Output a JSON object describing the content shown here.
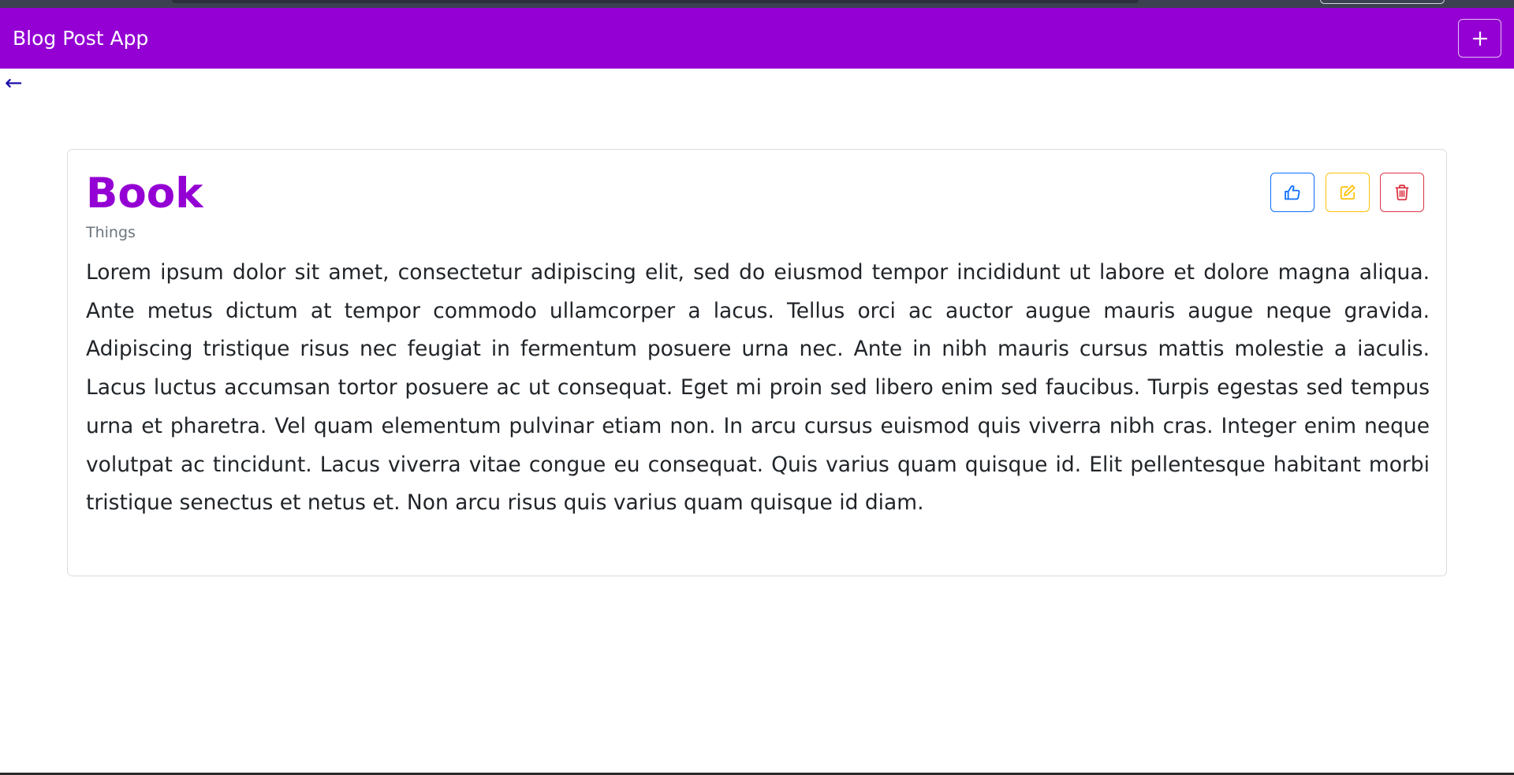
{
  "app": {
    "brand": "Blog Post App",
    "add_label": "+",
    "back_label": "←"
  },
  "post": {
    "title": "Book",
    "category": "Things",
    "body": "Lorem ipsum dolor sit amet, consectetur adipiscing elit, sed do eiusmod tempor incididunt ut labore et dolore magna aliqua. Ante metus dictum at tempor commodo ullamcorper a lacus. Tellus orci ac auctor augue mauris augue neque gravida. Adipiscing tristique risus nec feugiat in fermentum posuere urna nec. Ante in nibh mauris cursus mattis molestie a iaculis. Lacus luctus accumsan tortor posuere ac ut consequat. Eget mi proin sed libero enim sed faucibus. Turpis egestas sed tempus urna et pharetra. Vel quam elementum pulvinar etiam non. In arcu cursus euismod quis viverra nibh cras. Integer enim neque volutpat ac tincidunt. Lacus viverra vitae congue eu consequat. Quis varius quam quisque id. Elit pellentesque habitant morbi tristique senectus et netus et. Non arcu risus quis varius quam quisque id diam."
  },
  "actions": [
    {
      "icon": "thumbs-up-icon",
      "color": "#0d6efd"
    },
    {
      "icon": "edit-icon",
      "color": "#ffc107"
    },
    {
      "icon": "trash-icon",
      "color": "#dc3545"
    }
  ],
  "colors": {
    "brand": "#9400d3",
    "title": "#9400d3",
    "link": "#1a0dab",
    "muted": "#6c757d"
  }
}
